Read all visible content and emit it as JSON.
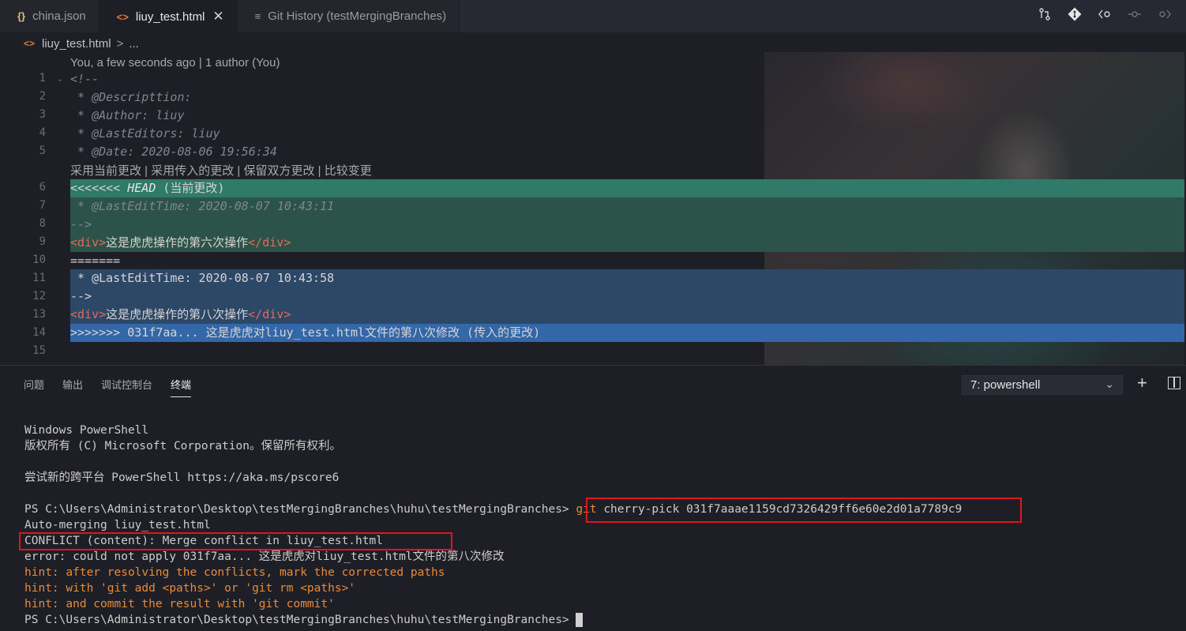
{
  "tabs": [
    {
      "icon": "{}",
      "label": "china.json",
      "close": ""
    },
    {
      "icon": "<>",
      "label": "liuy_test.html",
      "close": "✕"
    },
    {
      "icon": "≡",
      "label": "Git History (testMergingBranches)",
      "close": ""
    }
  ],
  "breadcrumb": {
    "icon": "<>",
    "file": "liuy_test.html",
    "sep": ">",
    "more": "..."
  },
  "editor": {
    "blame": "You, a few seconds ago | 1 author (You)",
    "codelens": "采用当前更改 | 采用传入的更改 | 保留双方更改 | 比较变更",
    "line_numbers": [
      "1",
      "2",
      "3",
      "4",
      "5",
      "6",
      "7",
      "8",
      "9",
      "10",
      "11",
      "12",
      "13",
      "14",
      "15"
    ],
    "lines": {
      "l1": "<!--",
      "l2": " * @Descripttion:",
      "l3": " * @Author: liuy",
      "l4": " * @LastEditors: liuy",
      "l5": " * @Date: 2020-08-06 19:56:34",
      "l6a": "<<<<<<< ",
      "l6b": "HEAD",
      "l6c": " (当前更改)",
      "l7": " * @LastEditTime: 2020-08-07 10:43:11",
      "l8": "-->",
      "l9_open": "<div>",
      "l9_text": "这是虎虎操作的第六次操作",
      "l9_close": "</div>",
      "l10": "=======",
      "l11": " * @LastEditTime: 2020-08-07 10:43:58",
      "l12": "-->",
      "l13_open": "<div>",
      "l13_text": "这是虎虎操作的第八次操作",
      "l13_close": "</div>",
      "l14": ">>>>>>> 031f7aa... 这是虎虎对liuy_test.html文件的第八次修改 (传入的更改)"
    }
  },
  "panel": {
    "tabs": [
      "问题",
      "输出",
      "调试控制台",
      "终端"
    ],
    "active_tab": "终端",
    "terminal_select": "7: powershell",
    "terminal": {
      "t1": "Windows PowerShell",
      "t2": "版权所有 (C) Microsoft Corporation。保留所有权利。",
      "t3": "尝试新的跨平台 PowerShell https://aka.ms/pscore6",
      "prompt": "PS C:\\Users\\Administrator\\Desktop\\testMergingBranches\\huhu\\testMergingBranches>",
      "cmd_git": "git",
      "cmd_rest": " cherry-pick 031f7aaae1159cd7326429ff6e60e2d01a7789c9",
      "t5": "Auto-merging liuy_test.html",
      "t6": "CONFLICT (content): Merge conflict in liuy_test.html",
      "t7": "error: could not apply 031f7aa... 这是虎虎对liuy_test.html文件的第八次修改",
      "t8": "hint: after resolving the conflicts, mark the corrected paths",
      "t9": "hint: with 'git add <paths>' or 'git rm <paths>'",
      "t10": "hint: and commit the result with 'git commit'",
      "prompt2": "PS C:\\Users\\Administrator\\Desktop\\testMergingBranches\\huhu\\testMergingBranches>"
    }
  },
  "colors": {
    "conflict_box": "#e0161c",
    "current_change": "#2f7a68",
    "incoming_change": "#3367a8",
    "hint": "#e88a3a"
  }
}
